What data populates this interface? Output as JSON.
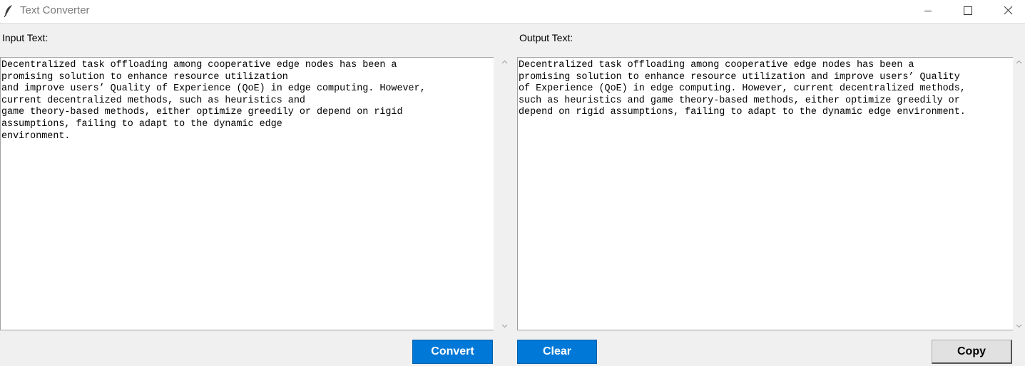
{
  "window": {
    "title": "Text Converter",
    "icon": "feather-icon"
  },
  "input": {
    "label": "Input Text:",
    "lines": [
      "Decentralized task offloading among cooperative edge nodes has been a",
      "promising solution to enhance resource utilization",
      "and improve users’ Quality of Experience (QoE) in edge computing. However,",
      "current decentralized methods, such as heuristics and",
      "game theory-based methods, either optimize greedily or depend on rigid",
      "assumptions, failing to adapt to the dynamic edge",
      "environment."
    ]
  },
  "output": {
    "label": "Output Text:",
    "lines": [
      "Decentralized task offloading among cooperative edge nodes has been a",
      "promising solution to enhance resource utilization and improve users’ Quality",
      "of Experience (QoE) in edge computing. However, current decentralized methods,",
      "such as heuristics and game theory-based methods, either optimize greedily or",
      "depend on rigid assumptions, failing to adapt to the dynamic edge environment."
    ]
  },
  "buttons": {
    "convert": "Convert",
    "clear": "Clear",
    "copy": "Copy"
  },
  "colors": {
    "accent": "#0078d7",
    "background": "#f0f0f0"
  }
}
